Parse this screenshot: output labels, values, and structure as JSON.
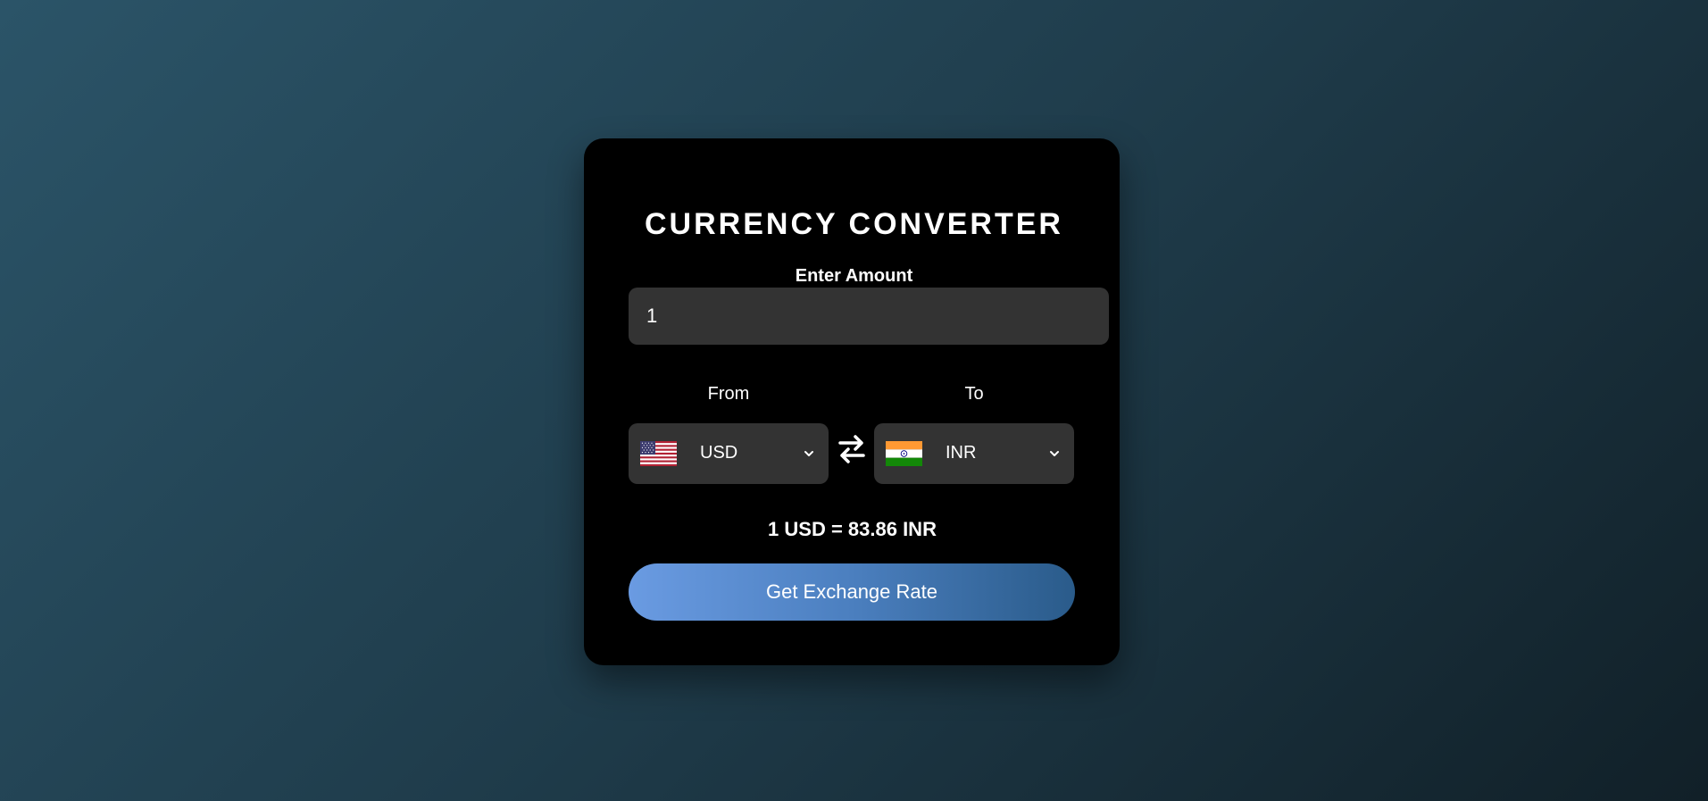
{
  "converter": {
    "title": "CURRENCY CONVERTER",
    "amount_label": "Enter Amount",
    "amount_value": "1",
    "from_label": "From",
    "to_label": "To",
    "from_currency": "USD",
    "to_currency": "INR",
    "from_flag": "us-flag-icon",
    "to_flag": "india-flag-icon",
    "swap_icon": "swap-arrows-icon",
    "rate_text": "1 USD = 83.86 INR",
    "button_label": "Get Exchange Rate"
  },
  "colors": {
    "background_start": "#2b5468",
    "background_end": "#112028",
    "card": "#000000",
    "field": "#333333",
    "button_start": "#6a9be2",
    "button_end": "#2a5b8a",
    "text": "#ffffff"
  }
}
